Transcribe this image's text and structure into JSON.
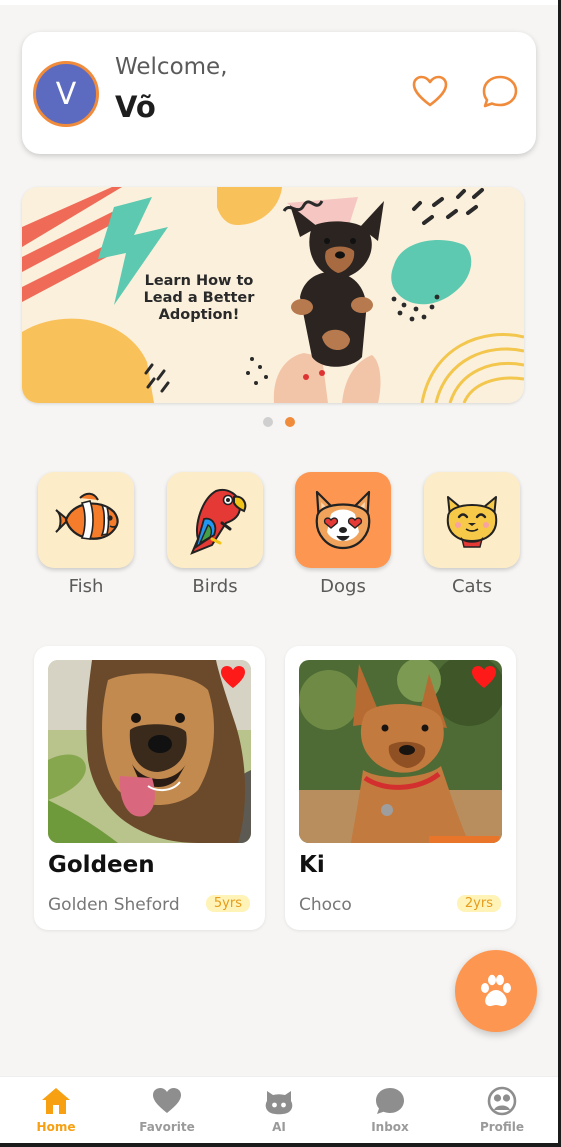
{
  "header": {
    "avatar_letter": "V",
    "welcome": "Welcome,",
    "username": "Võ"
  },
  "banner": {
    "text": "Learn How to Lead a Better Adoption!",
    "page_count": 2,
    "active_page": 2
  },
  "categories": [
    {
      "label": "Fish",
      "icon": "clownfish-icon",
      "active": false
    },
    {
      "label": "Birds",
      "icon": "parrot-icon",
      "active": false
    },
    {
      "label": "Dogs",
      "icon": "dog-face-icon",
      "active": true
    },
    {
      "label": "Cats",
      "icon": "cat-face-icon",
      "active": false
    }
  ],
  "pets": [
    {
      "name": "Goldeen",
      "breed": "Golden Sheford",
      "age": "5yrs",
      "favorite": true
    },
    {
      "name": "Ki",
      "breed": "Choco",
      "age": "2yrs",
      "favorite": true
    }
  ],
  "nav": [
    {
      "label": "Home",
      "icon": "home-icon",
      "active": true
    },
    {
      "label": "Favorite",
      "icon": "heart-icon",
      "active": false
    },
    {
      "label": "AI",
      "icon": "github-cat-icon",
      "active": false
    },
    {
      "label": "Inbox",
      "icon": "chat-bubble-icon",
      "active": false
    },
    {
      "label": "Profile",
      "icon": "profile-icon",
      "active": false
    }
  ],
  "colors": {
    "accent": "#fd9650",
    "active_nav": "#f7a012",
    "tile": "#fdecc8",
    "avatar": "#5c6bc0",
    "favorite_heart": "#ff1a1a"
  }
}
